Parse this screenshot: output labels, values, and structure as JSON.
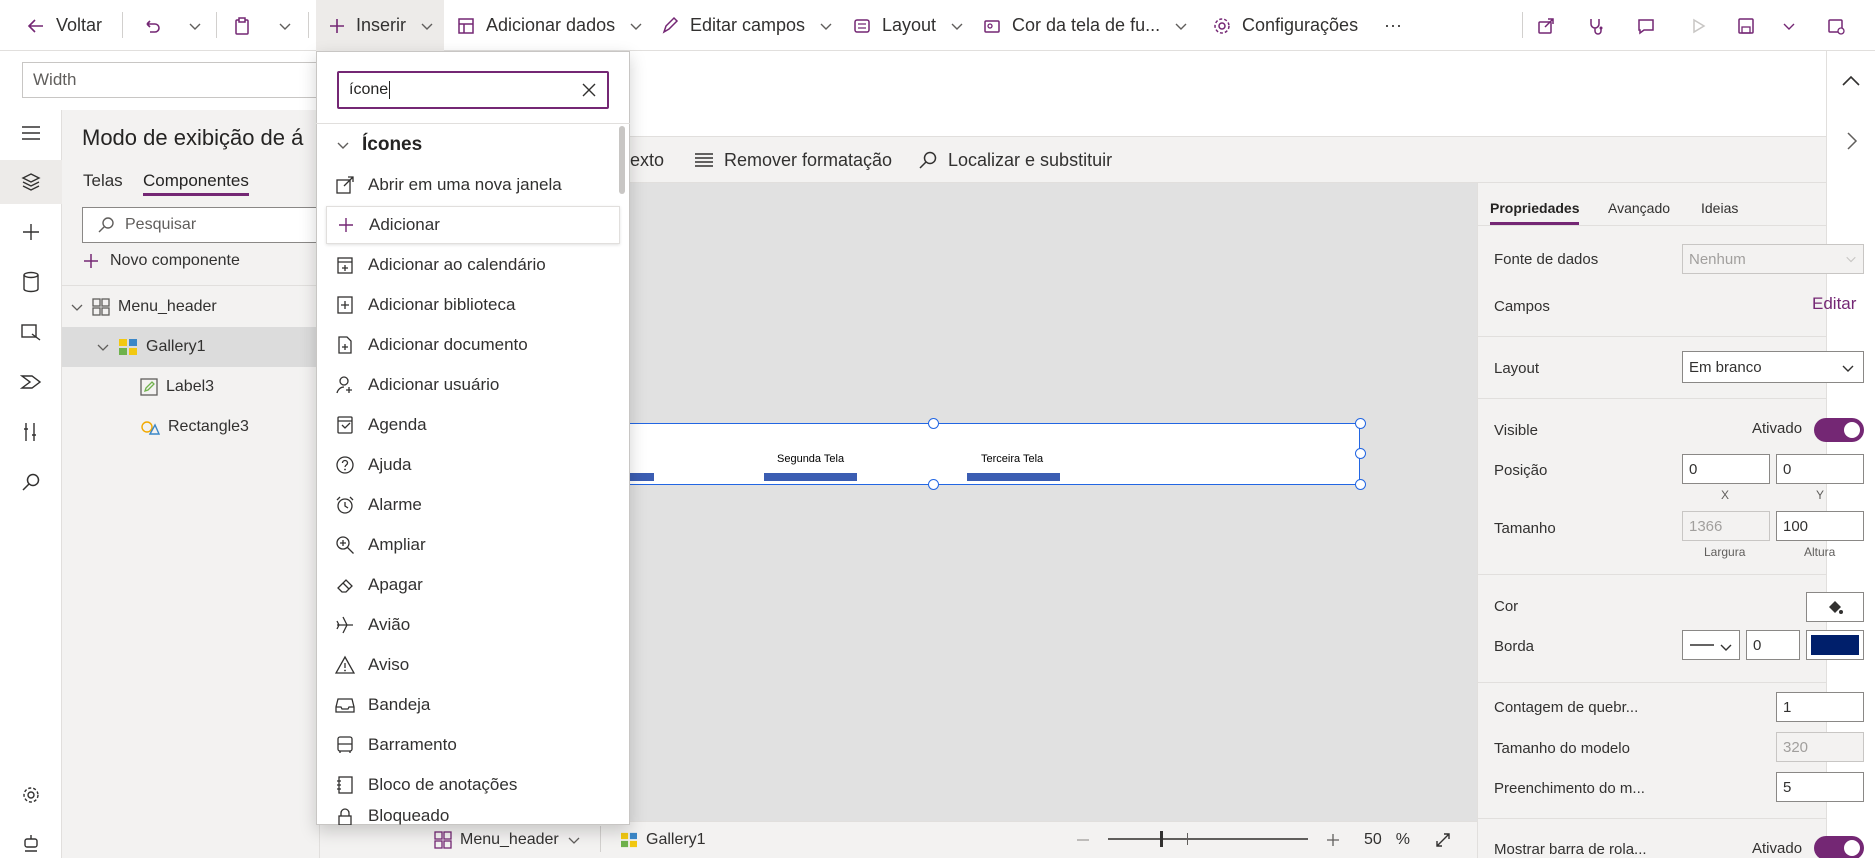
{
  "toolbar": {
    "back": "Voltar",
    "insert": "Inserir",
    "add_data": "Adicionar dados",
    "edit_fields": "Editar campos",
    "layout": "Layout",
    "background_color": "Cor da tela de fu...",
    "settings": "Configurações",
    "more": "···"
  },
  "formula": {
    "property": "Width"
  },
  "format_bar": {
    "text_partial": "exto",
    "remove_formatting": "Remover formatação",
    "find_replace": "Localizar e substituir"
  },
  "tree": {
    "title": "Modo de exibição de á",
    "tabs": [
      "Telas",
      "Componentes"
    ],
    "search_placeholder": "Pesquisar",
    "new_component": "Novo componente",
    "items": [
      {
        "label": "Menu_header"
      },
      {
        "label": "Gallery1"
      },
      {
        "label": "Label3"
      },
      {
        "label": "Rectangle3"
      }
    ]
  },
  "insert_menu": {
    "search_value": "ícone",
    "category": "Ícones",
    "items": [
      {
        "label": "Abrir em uma nova janela",
        "icon": "open-new-window-icon"
      },
      {
        "label": "Adicionar",
        "icon": "add-icon"
      },
      {
        "label": "Adicionar ao calendário",
        "icon": "add-to-calendar-icon"
      },
      {
        "label": "Adicionar biblioteca",
        "icon": "add-library-icon"
      },
      {
        "label": "Adicionar documento",
        "icon": "add-document-icon"
      },
      {
        "label": "Adicionar usuário",
        "icon": "add-user-icon"
      },
      {
        "label": "Agenda",
        "icon": "agenda-icon"
      },
      {
        "label": "Ajuda",
        "icon": "help-icon"
      },
      {
        "label": "Alarme",
        "icon": "alarm-icon"
      },
      {
        "label": "Ampliar",
        "icon": "zoom-in-icon"
      },
      {
        "label": "Apagar",
        "icon": "erase-icon"
      },
      {
        "label": "Avião",
        "icon": "airplane-icon"
      },
      {
        "label": "Aviso",
        "icon": "warning-icon"
      },
      {
        "label": "Bandeja",
        "icon": "tray-icon"
      },
      {
        "label": "Barramento",
        "icon": "bus-icon"
      },
      {
        "label": "Bloco de anotações",
        "icon": "notebook-icon"
      },
      {
        "label": "Bloqueado",
        "icon": "lock-icon"
      }
    ]
  },
  "canvas": {
    "gallery_labels": [
      "Segunda Tela",
      "Terceira Tela"
    ]
  },
  "bottom_bar": {
    "screen": "Menu_header",
    "control": "Gallery1",
    "zoom_value": "50",
    "zoom_unit": "%"
  },
  "properties": {
    "tabs": [
      "Propriedades",
      "Avançado",
      "Ideias"
    ],
    "data_source_label": "Fonte de dados",
    "data_source_value": "Nenhum",
    "fields_label": "Campos",
    "fields_action": "Editar",
    "layout_label": "Layout",
    "layout_value": "Em branco",
    "visible_label": "Visible",
    "visible_state": "Ativado",
    "position_label": "Posição",
    "position_x": "0",
    "position_y": "0",
    "x_label": "X",
    "y_label": "Y",
    "size_label": "Tamanho",
    "size_width": "1366",
    "size_height": "100",
    "width_label": "Largura",
    "height_label": "Altura",
    "color_label": "Cor",
    "border_label": "Borda",
    "border_value": "0",
    "border_color": "#001f6b",
    "wrap_count_label": "Contagem de quebr...",
    "wrap_count_value": "1",
    "template_size_label": "Tamanho do modelo",
    "template_size_value": "320",
    "template_padding_label": "Preenchimento do m...",
    "template_padding_value": "5",
    "scrollbar_label": "Mostrar barra de rola...",
    "scrollbar_state": "Ativado"
  },
  "colors": {
    "accent": "#742774",
    "selection": "#2266e3",
    "gallery_bar": "#3b5db2"
  }
}
